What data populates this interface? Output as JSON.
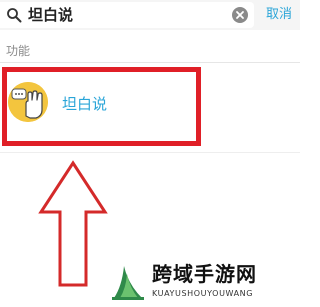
{
  "search": {
    "query": "坦白说",
    "cancel_label": "取消"
  },
  "section": {
    "label": "功能"
  },
  "results": [
    {
      "label": "坦白说",
      "icon": "hand-speech-icon"
    }
  ],
  "watermark": {
    "title": "跨域手游网",
    "subtitle": "KUAYUSHOUYOUWANG"
  },
  "colors": {
    "accent": "#2aa5d8",
    "highlight": "#e01f27",
    "icon_bg": "#f3c53e"
  }
}
